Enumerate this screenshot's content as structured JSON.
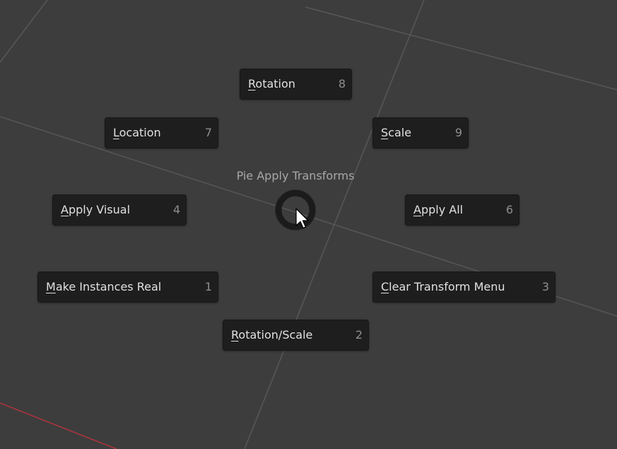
{
  "pie_menu": {
    "title": "Pie Apply Transforms",
    "items": [
      {
        "id": "rotation",
        "mnemonic": "R",
        "pre": "",
        "post": "otation",
        "label": "Rotation",
        "shortcut": "8"
      },
      {
        "id": "location",
        "mnemonic": "L",
        "pre": "",
        "post": "ocation",
        "label": "Location",
        "shortcut": "7"
      },
      {
        "id": "scale",
        "mnemonic": "S",
        "pre": "",
        "post": "cale",
        "label": "Scale",
        "shortcut": "9"
      },
      {
        "id": "apply-visual",
        "mnemonic": "A",
        "pre": "",
        "post": "pply Visual",
        "label": "Apply Visual",
        "shortcut": "4"
      },
      {
        "id": "apply-all",
        "mnemonic": "A",
        "pre": "",
        "post": "pply All",
        "label": "Apply All",
        "shortcut": "6"
      },
      {
        "id": "make-instances-real",
        "mnemonic": "M",
        "pre": "",
        "post": "ake Instances Real",
        "label": "Make Instances Real",
        "shortcut": "1"
      },
      {
        "id": "clear-transform-menu",
        "mnemonic": "C",
        "pre": "",
        "post": "lear Transform Menu",
        "label": "Clear Transform Menu",
        "shortcut": "3"
      },
      {
        "id": "rotation-scale",
        "mnemonic": "R",
        "pre": "",
        "post": "otation/Scale",
        "label": "Rotation/Scale",
        "shortcut": "2"
      }
    ]
  },
  "colors": {
    "viewport_bg": "#3d3d3d",
    "grid_line": "#5a5a5a",
    "x_axis": "#b0343e",
    "button_bg": "#1e1e1e",
    "button_text": "#e1e1e1",
    "shortcut_text": "#8f8f8f",
    "title_text": "#a8a8a8"
  },
  "icons": {
    "cursor": "mouse-pointer-icon",
    "pie_center": "pie-center-ring-icon"
  }
}
